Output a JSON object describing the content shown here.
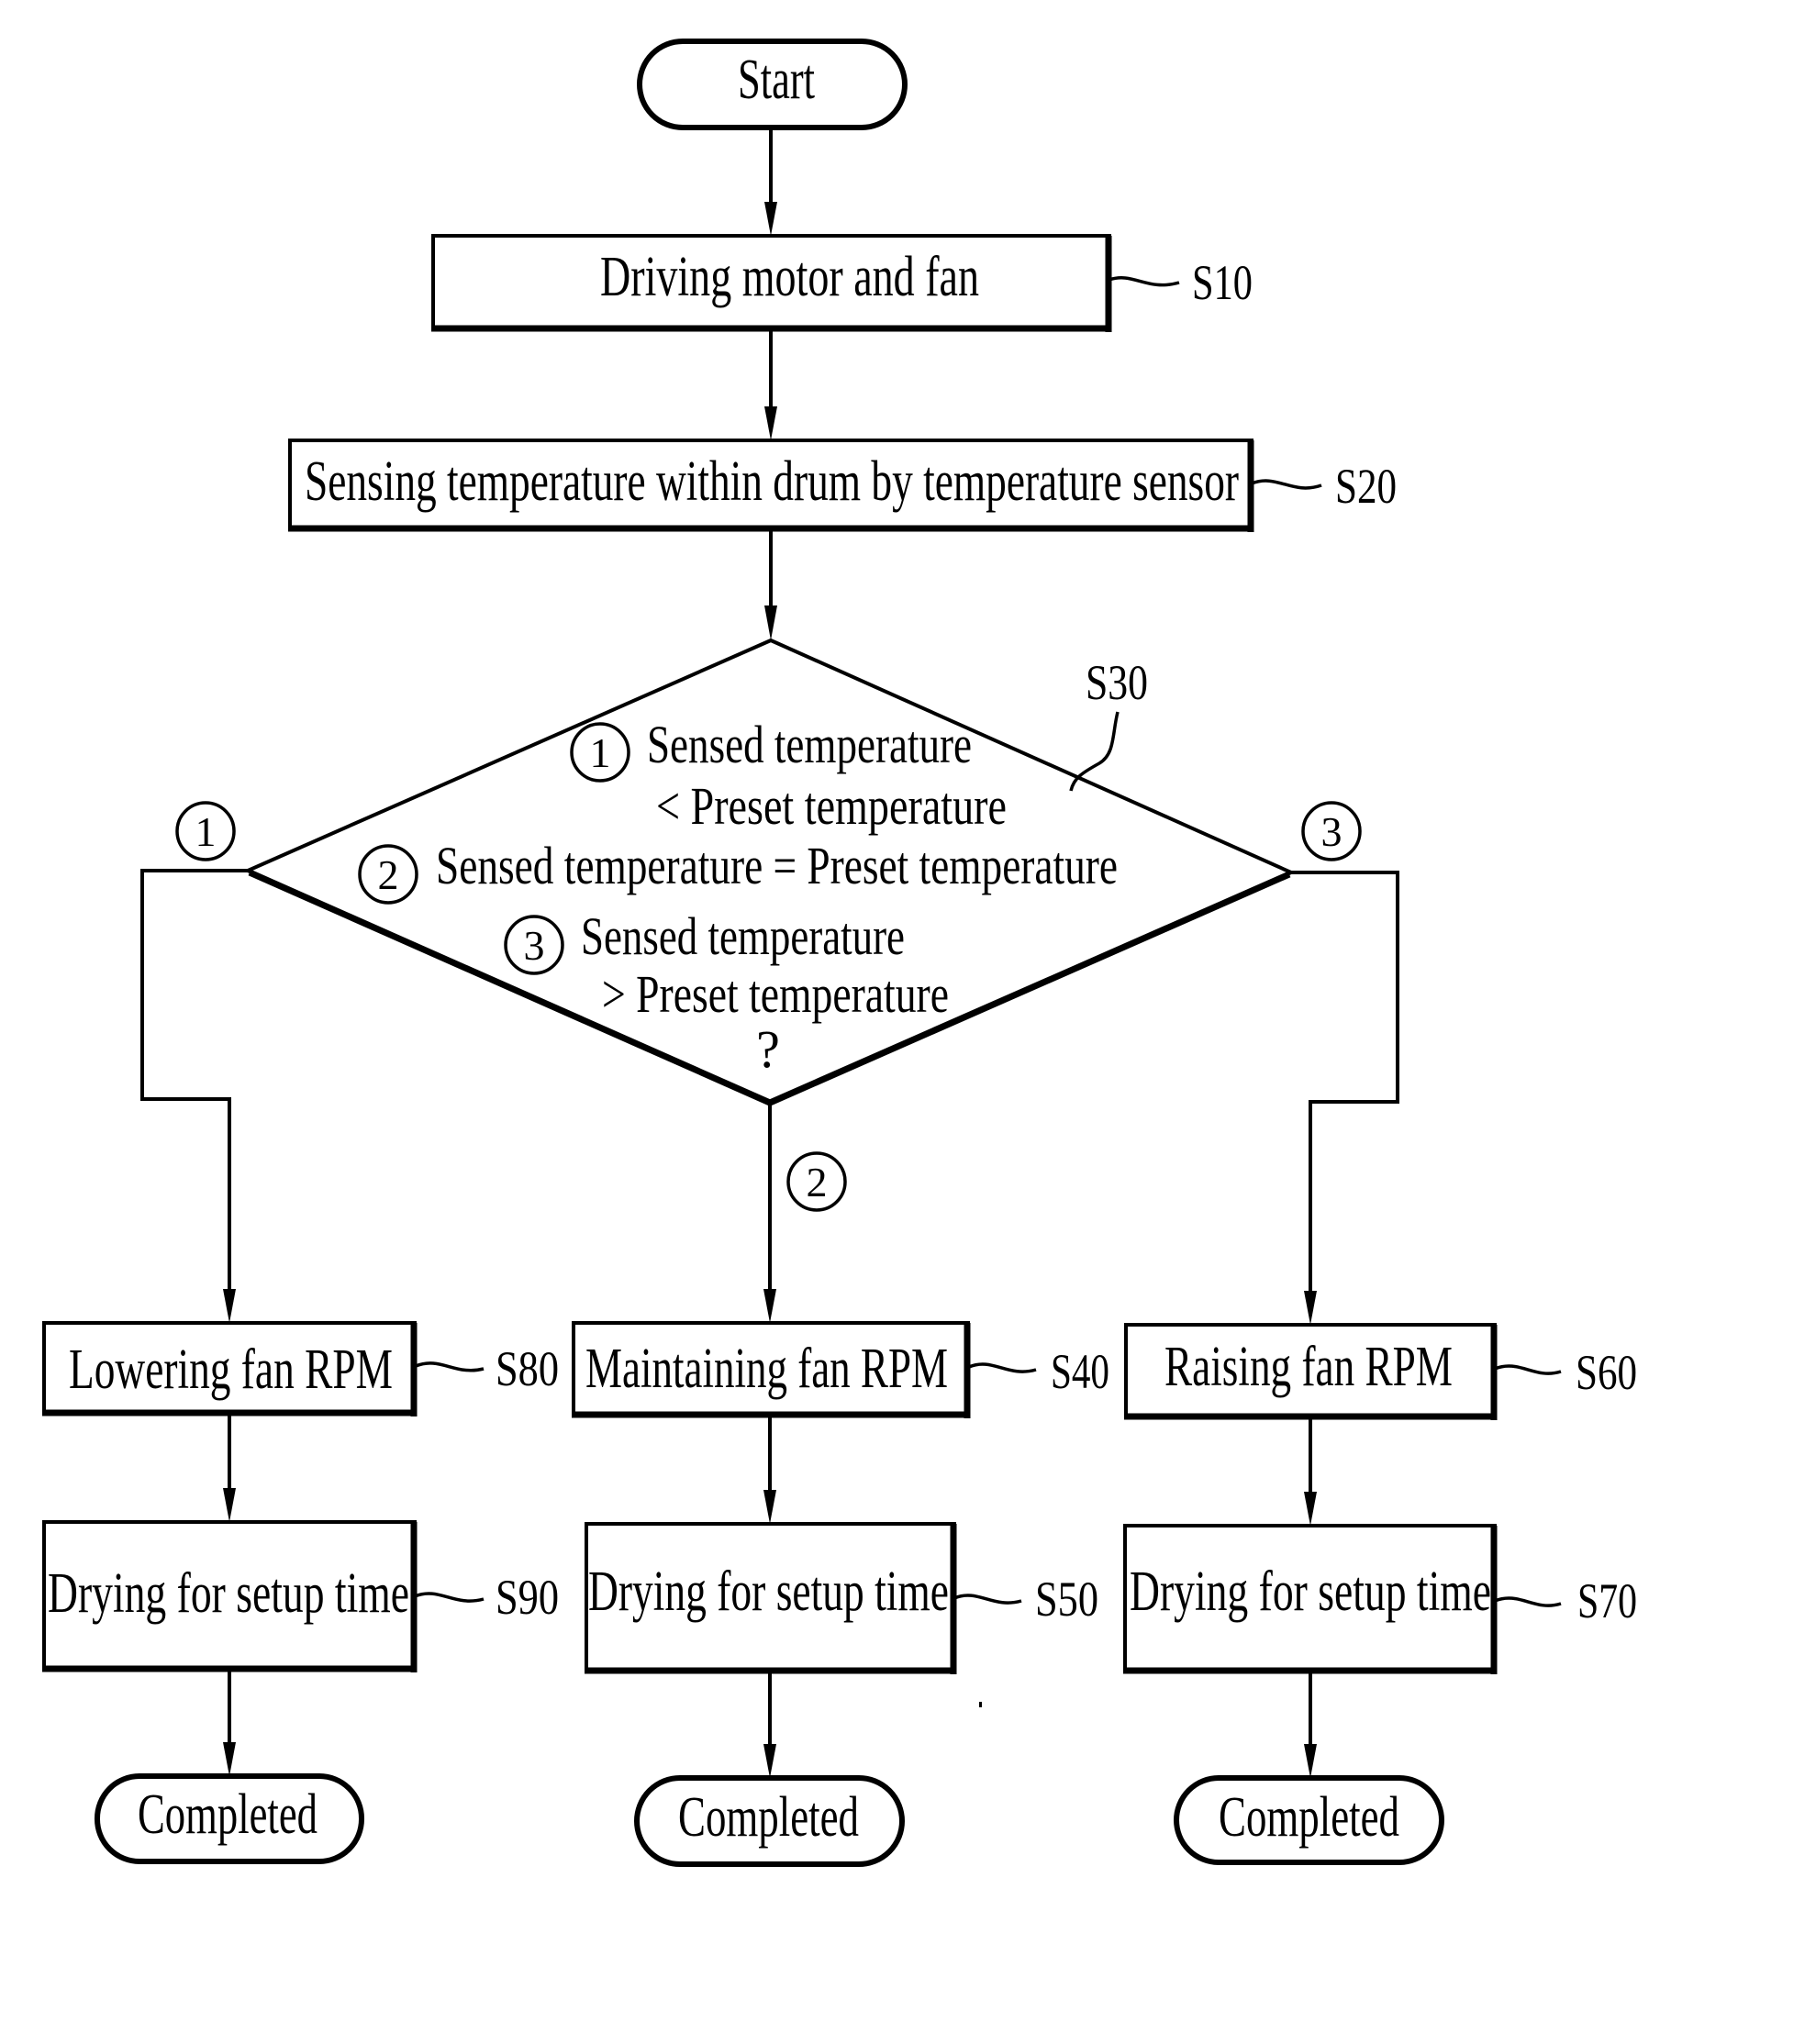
{
  "diagram": {
    "type": "flowchart",
    "colors": {
      "line": "#000000",
      "background": "#ffffff"
    },
    "start": {
      "label": "Start"
    },
    "steps": {
      "s10": {
        "label": "Driving motor and fan",
        "ref": "S10"
      },
      "s20": {
        "label": "Sensing temperature within drum by temperature sensor",
        "ref": "S20"
      },
      "s30": {
        "ref": "S30",
        "conditions": [
          {
            "marker": "1",
            "line1": "Sensed temperature",
            "line2": "< Preset temperature"
          },
          {
            "marker": "2",
            "line1": "Sensed temperature = Preset temperature"
          },
          {
            "marker": "3",
            "line1": "Sensed temperature",
            "line2": "> Preset temperature"
          }
        ],
        "question_mark": "?"
      },
      "s80": {
        "label": "Lowering fan RPM",
        "ref": "S80"
      },
      "s40": {
        "label": "Maintaining fan RPM",
        "ref": "S40"
      },
      "s60": {
        "label": "Raising fan RPM",
        "ref": "S60"
      },
      "s90": {
        "label": "Drying for setup time",
        "ref": "S90"
      },
      "s50": {
        "label": "Drying for setup time",
        "ref": "S50"
      },
      "s70": {
        "label": "Drying for setup time",
        "ref": "S70"
      }
    },
    "branches": {
      "left": {
        "marker": "1"
      },
      "middle": {
        "marker": "2"
      },
      "right": {
        "marker": "3"
      }
    },
    "ends": [
      {
        "label": "Completed"
      },
      {
        "label": "Completed"
      },
      {
        "label": "Completed"
      }
    ]
  }
}
